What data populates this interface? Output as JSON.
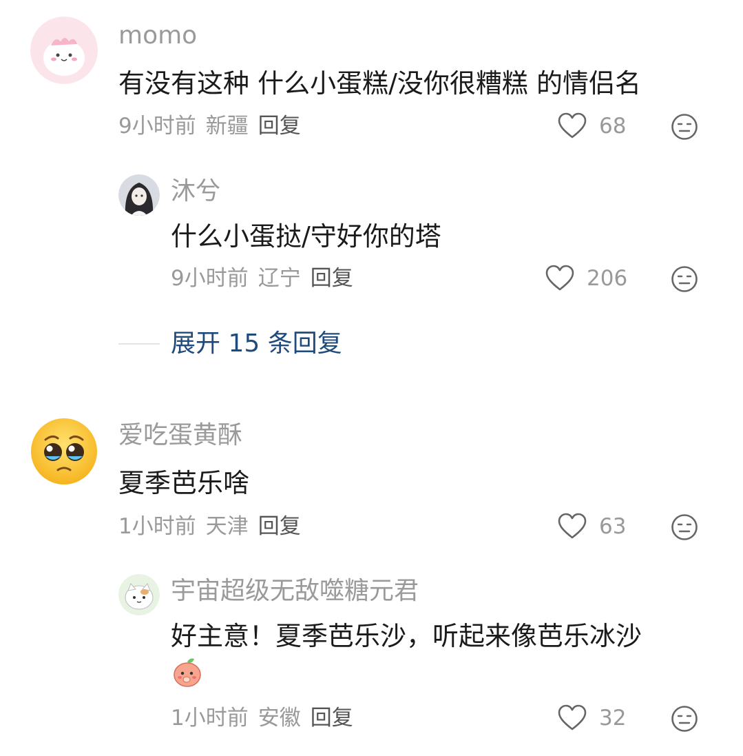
{
  "comments": [
    {
      "name": "momo",
      "text": "有没有这种  什么小蛋糕/没你很糟糕  的情侣名",
      "time": "9小时前",
      "location": "新疆",
      "reply_label": "回复",
      "likes": "68",
      "avatar_icon": "pink-blob-avatar",
      "replies": [
        {
          "name": "沐兮",
          "text": "什么小蛋挞/守好你的塔",
          "time": "9小时前",
          "location": "辽宁",
          "reply_label": "回复",
          "likes": "206",
          "avatar_icon": "anime-girl-avatar"
        }
      ],
      "expand_label": "展开 15 条回复"
    },
    {
      "name": "爱吃蛋黄酥",
      "text": "夏季芭乐啥",
      "time": "1小时前",
      "location": "天津",
      "reply_label": "回复",
      "likes": "63",
      "avatar_icon": "pleading-face-emoji-avatar",
      "replies": [
        {
          "name": "宇宙超级无敌噬糖元君",
          "text": "好主意！夏季芭乐沙，听起来像芭乐冰沙",
          "time": "1小时前",
          "location": "安徽",
          "reply_label": "回复",
          "likes": "32",
          "avatar_icon": "cat-avatar",
          "sticker": "peach-sticker"
        }
      ]
    }
  ],
  "colors": {
    "name": "#9a9a9a",
    "text": "#1a1a1a",
    "meta": "#999999",
    "expand_link": "#1f4b7c"
  }
}
